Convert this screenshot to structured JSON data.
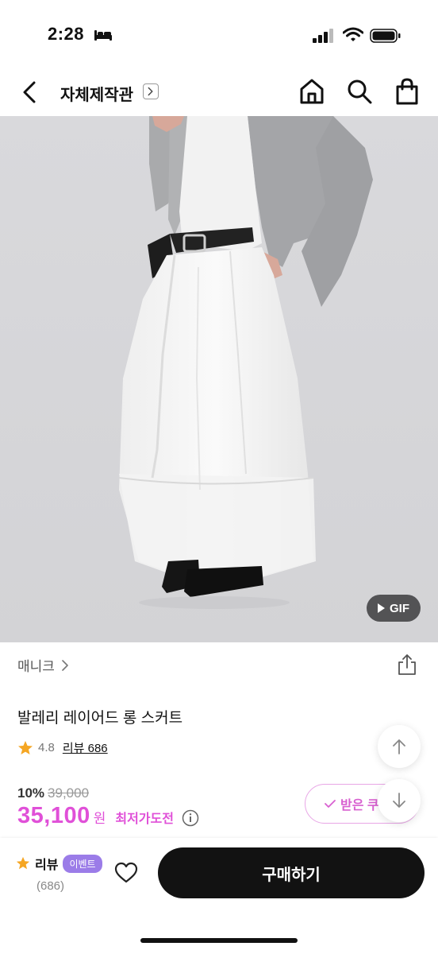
{
  "status_bar": {
    "time": "2:28",
    "icons": [
      "bed-icon",
      "signal-icon",
      "wifi-icon",
      "battery-icon"
    ]
  },
  "nav": {
    "title": "자체제작관",
    "icons": [
      "back-icon",
      "chevron-right-icon",
      "home-icon",
      "search-icon",
      "shopping-bag-icon"
    ]
  },
  "product": {
    "image_badge": "GIF",
    "brand": "매니크",
    "name": "발레리 레이어드 롱 스커트",
    "rating": "4.8",
    "review_link": "리뷰 686",
    "discount_rate": "10%",
    "original_price": "39,000",
    "sale_price": "35,100",
    "price_unit": "원",
    "lowest_price_label": "최저가도전",
    "coupon_button_label": "받은 쿠"
  },
  "bottom_bar": {
    "review_label": "리뷰",
    "event_badge": "이벤트",
    "review_count": "(686)",
    "buy_button_label": "구매하기"
  },
  "colors": {
    "accent_pink": "#e050d8",
    "star": "#f5a623",
    "event_badge": "#9b7ce8",
    "buy_button": "#121212",
    "image_background": "#d6d6d9"
  }
}
